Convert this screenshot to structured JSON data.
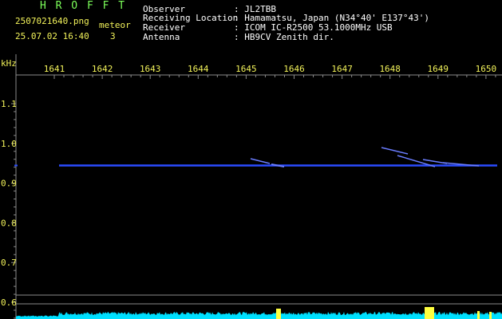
{
  "header": {
    "brand": "H R O F F T",
    "filename": "2507021640.png",
    "datetime": "25.07.02 16:40",
    "meteor_label": "meteor",
    "meteor_count": "3",
    "info": [
      {
        "label": "Observer",
        "value": ": JL2TBB"
      },
      {
        "label": "Receiving Location",
        "value": ": Hamamatsu, Japan (N34°40' E137°43')"
      },
      {
        "label": "Receiver",
        "value": ": ICOM IC-R2500 53.1000MHz USB"
      },
      {
        "label": "Antenna",
        "value": ": HB9CV Zenith dir."
      }
    ]
  },
  "axis": {
    "unit_label": "kHz",
    "time_ticks": [
      "1641",
      "1642",
      "1643",
      "1644",
      "1645",
      "1646",
      "1647",
      "1648",
      "1649",
      "1650"
    ],
    "freq_ticks": [
      "1.1",
      "1.0",
      "0.9",
      "0.8",
      "0.7",
      "0.6"
    ]
  },
  "colors": {
    "trace": "#2a4cff",
    "meteor": "#6a7dff",
    "tick_label": "#f2f25a",
    "header_text": "#7cff5a",
    "info_text": "#ffffff",
    "noise": "#00e0ff",
    "noise_peak": "#ffff40",
    "grid": "#8a8a8a"
  }
}
